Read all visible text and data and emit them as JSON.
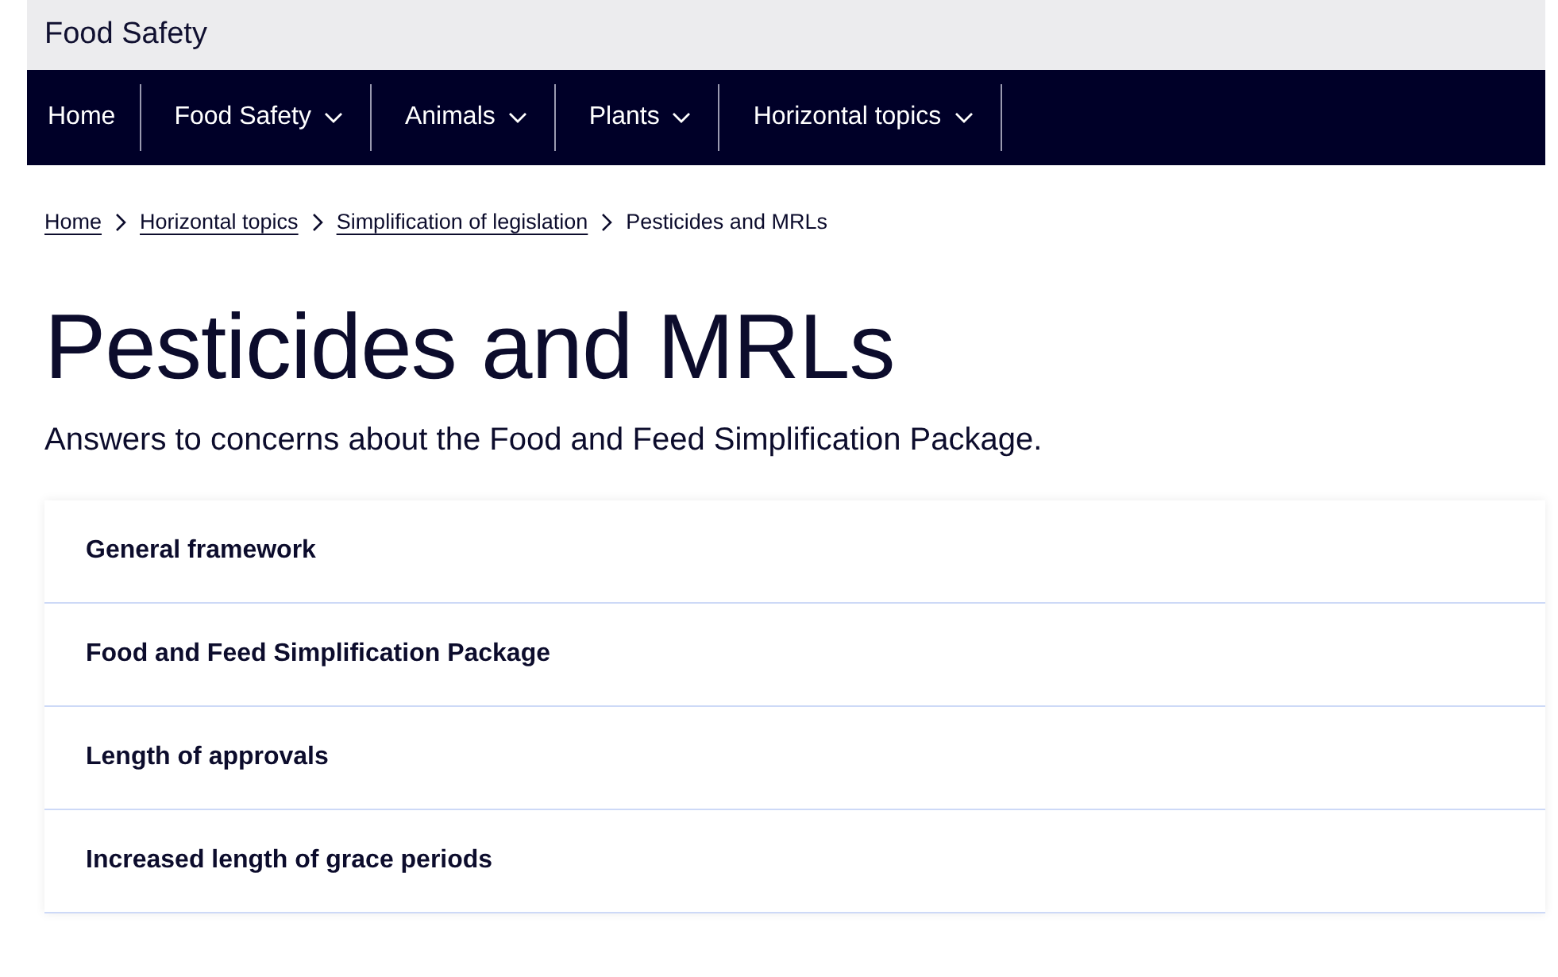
{
  "site_header": {
    "title": "Food Safety"
  },
  "nav": [
    {
      "label": "Home",
      "dropdown": false
    },
    {
      "label": "Food Safety",
      "dropdown": true
    },
    {
      "label": "Animals",
      "dropdown": true
    },
    {
      "label": "Plants",
      "dropdown": true
    },
    {
      "label": "Horizontal topics",
      "dropdown": true
    }
  ],
  "breadcrumb": [
    {
      "label": "Home",
      "link": true
    },
    {
      "label": "Horizontal topics",
      "link": true
    },
    {
      "label": "Simplification of legislation",
      "link": true
    },
    {
      "label": "Pesticides and MRLs",
      "link": false
    }
  ],
  "page": {
    "title": "Pesticides and MRLs",
    "subtitle": "Answers to concerns about the Food and Feed Simplification Package."
  },
  "accordion": [
    {
      "label": "General framework"
    },
    {
      "label": "Food and Feed Simplification Package"
    },
    {
      "label": "Length of approvals"
    },
    {
      "label": "Increased length of grace periods"
    }
  ]
}
